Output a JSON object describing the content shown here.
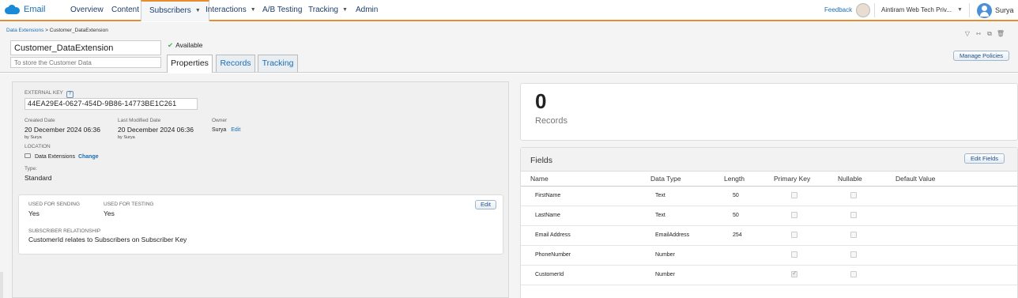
{
  "app": {
    "name": "Email"
  },
  "nav": {
    "items": [
      {
        "label": "Overview",
        "has_caret": false
      },
      {
        "label": "Content",
        "has_caret": false
      },
      {
        "label": "Subscribers",
        "has_caret": true,
        "active": true
      },
      {
        "label": "Interactions",
        "has_caret": true
      },
      {
        "label": "A/B Testing",
        "has_caret": false
      },
      {
        "label": "Tracking",
        "has_caret": true
      },
      {
        "label": "Admin",
        "has_caret": false
      }
    ],
    "feedback": "Feedback",
    "business_unit": "Aintiram Web Tech Priv...",
    "user": "Surya"
  },
  "breadcrumb": {
    "parent": "Data Extensions",
    "separator": " > ",
    "current": "Customer_DataExtension"
  },
  "extension": {
    "name": "Customer_DataExtension",
    "description_placeholder": "To store the Customer Data",
    "status": "Available"
  },
  "tabs": [
    "Properties",
    "Records",
    "Tracking"
  ],
  "active_tab": "Properties",
  "manage_policies": "Manage Policies",
  "properties": {
    "external_key_label": "EXTERNAL KEY",
    "external_key": "44EA29E4-0627-454D-9B86-14773BE1C261",
    "created_label": "Created Date",
    "created_value": "20 December 2024 06:36",
    "created_by": "by Surya",
    "modified_label": "Last Modified Date",
    "modified_value": "20 December 2024 06:36",
    "modified_by": "by Surya",
    "owner_label": "Owner",
    "owner_value": "Surya",
    "owner_edit": "Edit",
    "location_label": "LOCATION",
    "location_value": "Data Extensions",
    "location_change": "Change",
    "type_label": "Type:",
    "type_value": "Standard",
    "used_sending_label": "USED FOR SENDING",
    "used_sending_value": "Yes",
    "used_testing_label": "USED FOR TESTING",
    "used_testing_value": "Yes",
    "edit": "Edit",
    "sub_rel_label": "SUBSCRIBER RELATIONSHIP",
    "sub_rel_value": "CustomerId relates to Subscribers on Subscriber Key"
  },
  "records": {
    "count": "0",
    "label": "Records"
  },
  "fields": {
    "title": "Fields",
    "edit_button": "Edit Fields",
    "columns": [
      "Name",
      "Data Type",
      "Length",
      "Primary Key",
      "Nullable",
      "Default Value"
    ],
    "rows": [
      {
        "name": "FirstName",
        "type": "Text",
        "length": "50",
        "primary_key": false,
        "nullable": false
      },
      {
        "name": "LastName",
        "type": "Text",
        "length": "50",
        "primary_key": false,
        "nullable": false
      },
      {
        "name": "Email Address",
        "type": "EmailAddress",
        "length": "254",
        "primary_key": false,
        "nullable": false
      },
      {
        "name": "PhoneNumber",
        "type": "Number",
        "length": "",
        "primary_key": false,
        "nullable": false
      },
      {
        "name": "CustomerId",
        "type": "Number",
        "length": "",
        "primary_key": true,
        "nullable": false
      }
    ]
  },
  "colors": {
    "accent_orange": "#e88c30",
    "link_blue": "#1a6eb3",
    "available_green": "#4caf50"
  }
}
